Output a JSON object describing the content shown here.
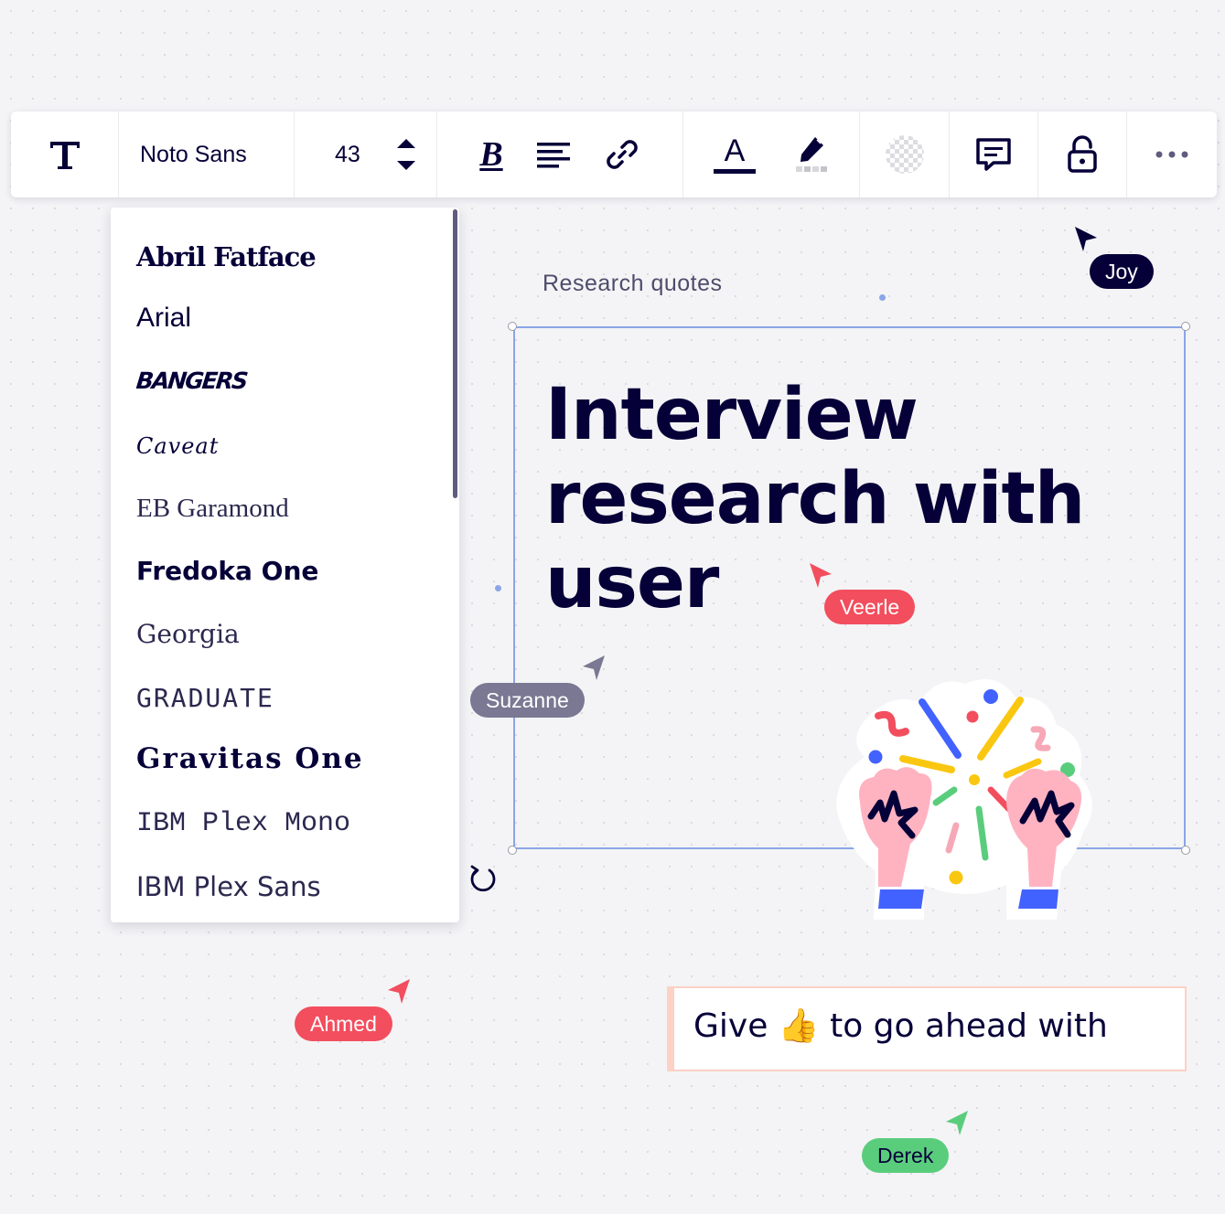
{
  "toolbar": {
    "text_tool_icon": "text-T-icon",
    "font_family": "Noto Sans",
    "font_size": "43",
    "icons": {
      "stepper": "up-down-stepper-icon",
      "bold": "bold-icon",
      "align": "align-left-icon",
      "link": "link-icon",
      "text_color": "text-color-icon",
      "highlight": "highlighter-icon",
      "fill": "transparent-fill-icon",
      "comment": "comment-icon",
      "lock": "unlock-icon",
      "more": "more-horizontal-icon"
    },
    "bold_glyph": "B",
    "text_color_glyph": "A"
  },
  "font_dropdown": {
    "items": [
      "Abril Fatface",
      "Arial",
      "BANGERS",
      "Caveat",
      "EB Garamond",
      "Fredoka One",
      "Georgia",
      "GRADUATE",
      "Gravitas One",
      "IBM Plex Mono",
      "IBM Plex Sans"
    ]
  },
  "canvas": {
    "frame_label": "Research quotes",
    "headline": "Interview research with user",
    "sticky_note": {
      "text_before": "Give",
      "emoji": "👍",
      "text_after": "to go ahead with"
    },
    "illustration": "celebrating-fists-confetti"
  },
  "collaborators": [
    {
      "name": "Joy",
      "color": "#050038"
    },
    {
      "name": "Veerle",
      "color": "#f24e5e"
    },
    {
      "name": "Suzanne",
      "color": "#7a7892"
    },
    {
      "name": "Ahmed",
      "color": "#f24e5e"
    },
    {
      "name": "Derek",
      "color": "#5acd7d"
    }
  ],
  "colors": {
    "accent_selection": "#8aa6e6",
    "ink": "#050038",
    "note_border": "#fdd1c4"
  }
}
